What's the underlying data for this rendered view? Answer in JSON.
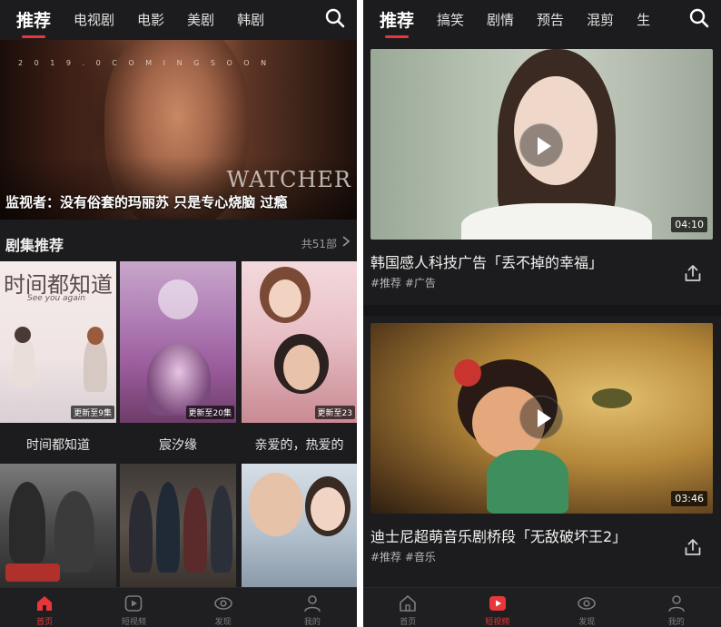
{
  "colors": {
    "accent": "#e8373b",
    "background": "#1c1c1e"
  },
  "left_screen": {
    "nav": {
      "tabs": [
        "推荐",
        "电视剧",
        "电影",
        "美剧",
        "韩剧"
      ],
      "active_tab": "推荐",
      "search_icon": "search-icon"
    },
    "hero": {
      "banner_text": "2 0 1 9 . 0   C O M I N G   S O O N",
      "brand_text": "WATCHER",
      "caption": "监视者：没有俗套的玛丽苏 只是专心烧脑 过瘾"
    },
    "series_section": {
      "title": "剧集推荐",
      "count": "共51部",
      "arrow_icon": "chevron-right-icon",
      "posters": [
        {
          "title": "时间都知道",
          "badge": "更新至9集",
          "art_title": "时间都知道",
          "art_subtitle": "See you again"
        },
        {
          "title": "宸汐缘",
          "badge": "更新至20集"
        },
        {
          "title": "亲爱的，热爱的",
          "badge": "更新至23"
        },
        {
          "title": "",
          "badge": ""
        },
        {
          "title": "",
          "badge": ""
        },
        {
          "title": "",
          "badge": ""
        }
      ]
    },
    "bottom_nav": [
      {
        "label": "首页",
        "icon": "home-icon",
        "active": true
      },
      {
        "label": "短视频",
        "icon": "play-icon",
        "active": false
      },
      {
        "label": "发现",
        "icon": "eye-icon",
        "active": false
      },
      {
        "label": "我的",
        "icon": "user-icon",
        "active": false
      }
    ]
  },
  "right_screen": {
    "nav": {
      "tabs": [
        "推荐",
        "搞笑",
        "剧情",
        "预告",
        "混剪",
        "生"
      ],
      "active_tab": "推荐",
      "search_icon": "search-icon"
    },
    "cards": [
      {
        "title": "韩国感人科技广告「丢不掉的幸福」",
        "tags": "#推荐 #广告",
        "duration": "04:10"
      },
      {
        "title": "迪士尼超萌音乐剧桥段「无敌破坏王2」",
        "tags": "#推荐 #音乐",
        "duration": "03:46"
      }
    ],
    "bottom_nav": [
      {
        "label": "首页",
        "icon": "home-icon",
        "active": false
      },
      {
        "label": "短视频",
        "icon": "play-icon",
        "active": true
      },
      {
        "label": "发现",
        "icon": "eye-icon",
        "active": false
      },
      {
        "label": "我的",
        "icon": "user-icon",
        "active": false
      }
    ]
  }
}
